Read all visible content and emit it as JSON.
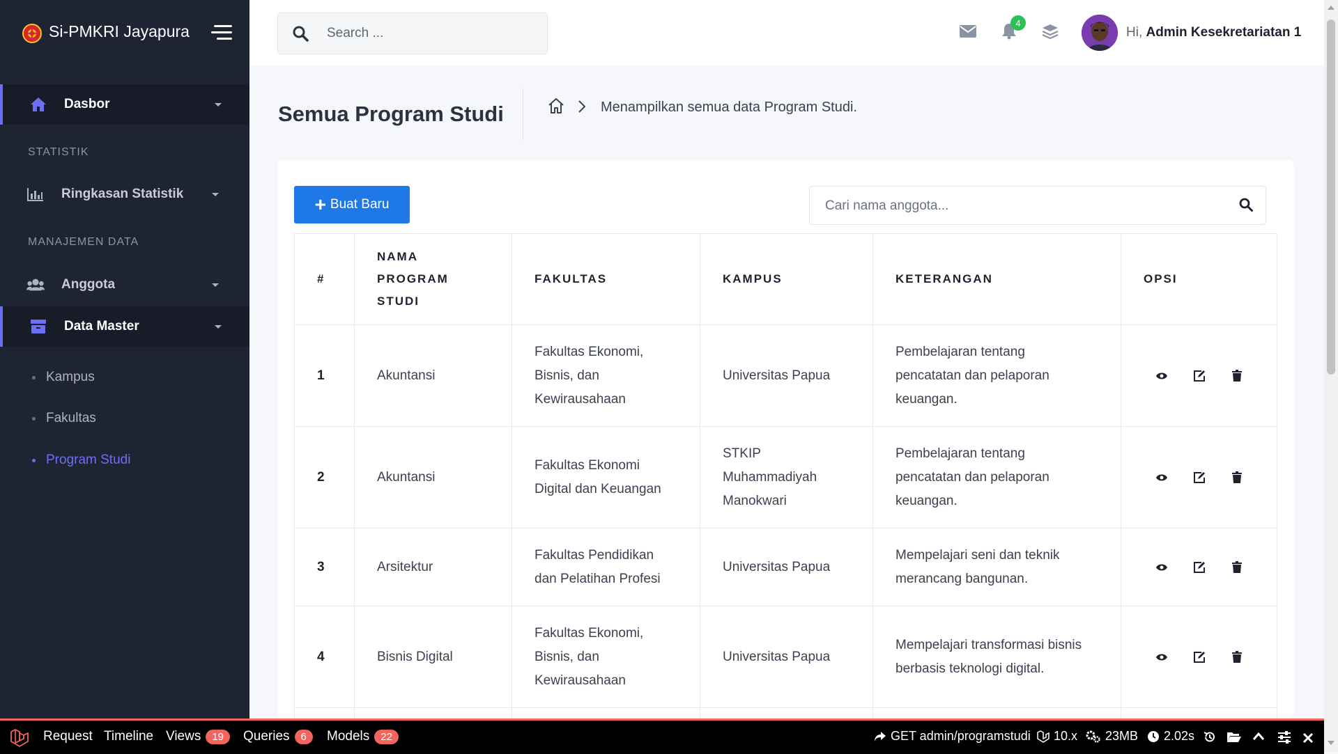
{
  "app": {
    "title": "Si-PMKRI Jayapura"
  },
  "sidebar": {
    "dasbor": "Dasbor",
    "section_statistik": "STATISTIK",
    "ringkasan": "Ringkasan Statistik",
    "section_manajemen": "MANAJEMEN DATA",
    "anggota": "Anggota",
    "data_master": "Data Master",
    "sub_items": [
      "Kampus",
      "Fakultas",
      "Program Studi"
    ],
    "accent_color": "#6c6ff5"
  },
  "topbar": {
    "search_placeholder": "Search ...",
    "notif_count": "4",
    "greeting": "Hi,",
    "user_name": "Admin Kesekretariatan 1"
  },
  "page": {
    "title": "Semua Program Studi",
    "breadcrumb": "Menampilkan semua data Program Studi."
  },
  "toolbar": {
    "new_label": "Buat Baru",
    "search_placeholder": "Cari nama anggota..."
  },
  "table": {
    "headers": [
      "#",
      "NAMA PROGRAM STUDI",
      "FAKULTAS",
      "KAMPUS",
      "KETERANGAN",
      "OPSI"
    ],
    "rows": [
      {
        "no": "1",
        "nama": "Akuntansi",
        "fakultas": "Fakultas Ekonomi, Bisnis, dan Kewirausahaan",
        "kampus": "Universitas Papua",
        "keterangan": "Pembelajaran tentang pencatatan dan pelaporan keuangan."
      },
      {
        "no": "2",
        "nama": "Akuntansi",
        "fakultas": "Fakultas Ekonomi Digital dan Keuangan",
        "kampus": "STKIP Muhammadiyah Manokwari",
        "keterangan": "Pembelajaran tentang pencatatan dan pelaporan keuangan."
      },
      {
        "no": "3",
        "nama": "Arsitektur",
        "fakultas": "Fakultas Pendidikan dan Pelatihan Profesi",
        "kampus": "Universitas Papua",
        "keterangan": "Mempelajari seni dan teknik merancang bangunan."
      },
      {
        "no": "4",
        "nama": "Bisnis Digital",
        "fakultas": "Fakultas Ekonomi, Bisnis, dan Kewirausahaan",
        "kampus": "Universitas Papua",
        "keterangan": "Mempelajari transformasi bisnis berbasis teknologi digital."
      }
    ]
  },
  "debugbar": {
    "request": "Request",
    "timeline": "Timeline",
    "views": "Views",
    "views_count": "19",
    "queries": "Queries",
    "queries_count": "6",
    "models": "Models",
    "models_count": "22",
    "route": "GET admin/programstudi",
    "version": "10.x",
    "memory": "23MB",
    "time": "2.02s"
  },
  "icons": {
    "brand": "pmkri-logo-icon",
    "menu": "hamburger-icon",
    "search": "search-icon",
    "mail": "mail-icon",
    "bell": "bell-icon",
    "layers": "layers-icon",
    "home": "home-icon",
    "view": "eye-icon",
    "edit": "edit-icon",
    "delete": "trash-icon"
  }
}
